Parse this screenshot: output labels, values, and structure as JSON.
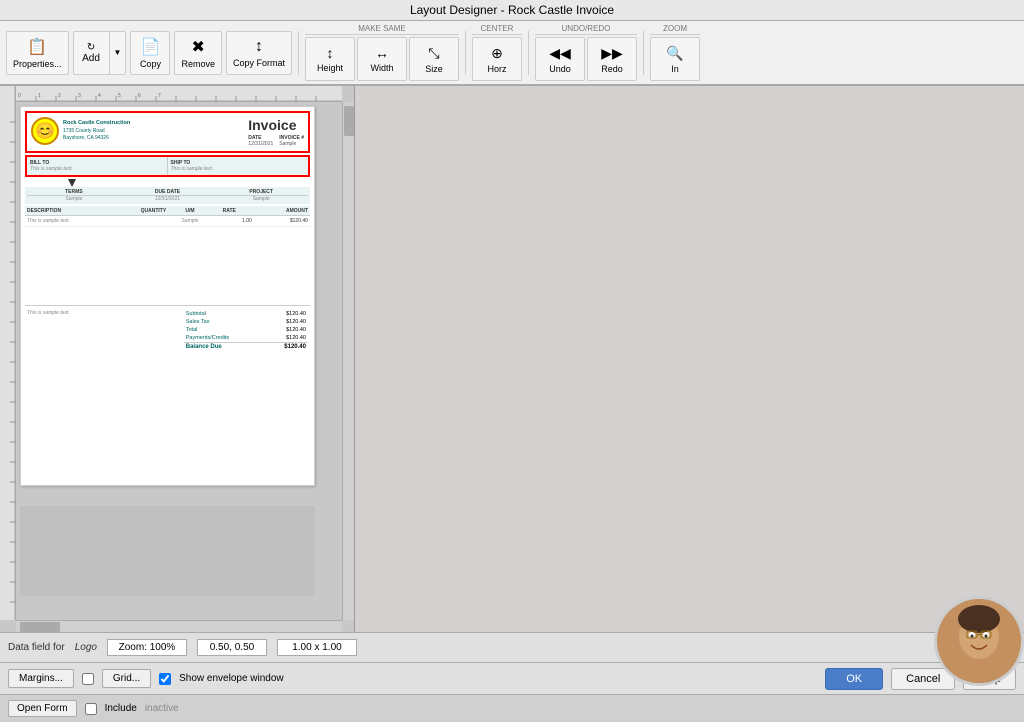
{
  "titleBar": {
    "title": "Layout Designer - Rock Castle Invoice"
  },
  "toolbar": {
    "properties_label": "Properties...",
    "add_label": "Add",
    "copy_label": "Copy",
    "remove_label": "Remove",
    "copy_format_label": "Copy Format",
    "make_same_label": "MAKE SAME",
    "height_label": "Height",
    "width_label": "Width",
    "size_label": "Size",
    "center_label": "CENTER",
    "horz_label": "Horz",
    "undo_redo_label": "UNDO/REDO",
    "undo_label": "Undo",
    "redo_label": "Redo",
    "zoom_label": "ZOOM",
    "zoom_in_label": "In"
  },
  "invoice": {
    "title": "Invoice",
    "company_name": "Rock Castle Construction",
    "company_address": "1735 County Road",
    "company_city": "Bayshore, CA 94326",
    "date_label": "DATE",
    "date_value": "12/31/2021",
    "invoice_label": "INVOICE #",
    "invoice_value": "Sample",
    "bill_to_label": "BILL TO",
    "bill_sample": "This is sample text.",
    "ship_to_label": "SHIP TO",
    "ship_sample": "This is sample text.",
    "terms_label": "TERMS",
    "terms_value": "Sample",
    "due_date_label": "DUE DATE",
    "due_date_value": "12/31/2021",
    "project_label": "PROJECT",
    "project_value": "Sample",
    "desc_label": "DESCRIPTION",
    "qty_label": "QUANTITY",
    "um_label": "U/M",
    "rate_label": "RATE",
    "amount_label": "AMOUNT",
    "item_sample_text": "This is sample text.",
    "item_unit": "Sample",
    "item_rate": "1.00",
    "item_amount": "$120.40",
    "footer_sample": "This is sample text.",
    "subtotal_label": "Subtotal",
    "subtotal_value": "$120.40",
    "sales_tax_label": "Sales Tax",
    "sales_tax_value": "$120.40",
    "total_label": "Total",
    "total_value": "$120.40",
    "payments_label": "Payments/Credits",
    "payments_value": "$120.40",
    "balance_due_label": "Balance Due",
    "balance_due_value": "$120.40"
  },
  "statusBar": {
    "data_field_label": "Data field for",
    "data_field_value": "Logo",
    "zoom_label": "Zoom: 100%",
    "coords": "0.50, 0.50",
    "size": "1.00 x 1.00"
  },
  "bottomBar": {
    "margins_label": "Margins...",
    "grid_label": "Grid...",
    "show_envelope_label": "Show envelope window",
    "ok_label": "OK",
    "cancel_label": "Cancel",
    "help_label": "Help"
  },
  "formBar": {
    "open_form_label": "Open Form",
    "include_label": "Include",
    "inactive_label": "inactive"
  },
  "colors": {
    "accent": "#4a7cc7",
    "teal": "#006666",
    "selected_border": "#ff0000",
    "bg": "#c0c0c0"
  }
}
